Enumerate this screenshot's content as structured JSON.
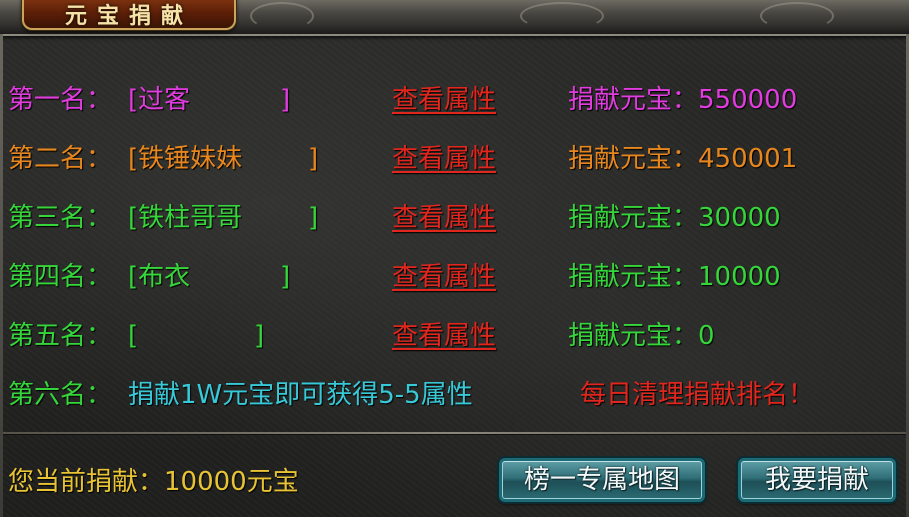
{
  "title": "元宝捐献",
  "colors": {
    "rank1": "#e23be0",
    "rank2": "#e8861e",
    "rank3": "#35d63a",
    "rank4": "#35d63a",
    "rank5": "#35d63a",
    "rank6_label": "#35d63a",
    "rank6_note": "#38c9d8",
    "link": "#e0261d",
    "notice": "#e0261d",
    "current": "#e8c334"
  },
  "ranks": [
    {
      "label": "第一名：",
      "name_open": "[过客",
      "name_close": "]",
      "link": "查看属性",
      "amount": "捐献元宝：550000"
    },
    {
      "label": "第二名：",
      "name_open": "[铁锤妹妹",
      "name_close": "]",
      "link": "查看属性",
      "amount": "捐献元宝：450001"
    },
    {
      "label": "第三名：",
      "name_open": "[铁柱哥哥",
      "name_close": "]",
      "link": "查看属性",
      "amount": "捐献元宝：30000"
    },
    {
      "label": "第四名：",
      "name_open": "[布衣",
      "name_close": "]",
      "link": "查看属性",
      "amount": "捐献元宝：10000"
    },
    {
      "label": "第五名：",
      "name_open": "[",
      "name_close": "]",
      "link": "查看属性",
      "amount": "捐献元宝：0"
    }
  ],
  "rank6": {
    "label": "第六名：",
    "note": "捐献1W元宝即可获得5-5属性"
  },
  "notice": "每日清理捐献排名！",
  "current_donation": "您当前捐献：10000元宝",
  "buttons": {
    "map": "榜一专属地图",
    "donate": "我要捐献"
  }
}
